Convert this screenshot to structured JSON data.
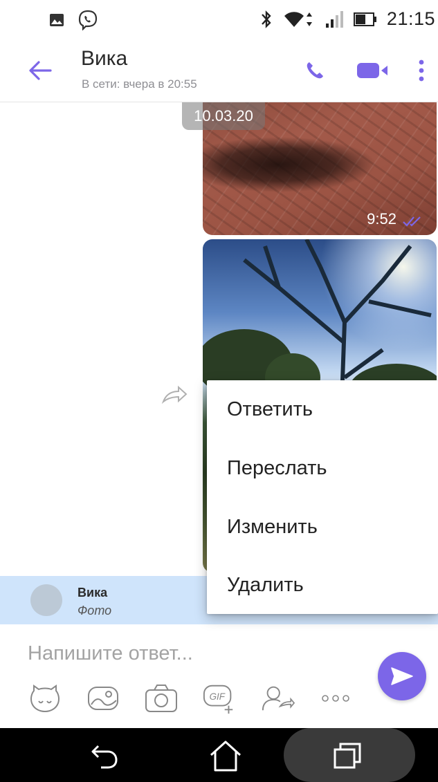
{
  "status_bar": {
    "time": "21:15",
    "icons_left": [
      "image-icon",
      "viber-icon"
    ],
    "icons_right": [
      "bluetooth-icon",
      "wifi-icon",
      "signal-icon",
      "battery-icon"
    ]
  },
  "header": {
    "contact_name": "Вика",
    "contact_status": "В сети: вчера в 20:55",
    "icons": [
      "back-arrow-icon",
      "phone-icon",
      "video-icon",
      "more-vertical-icon"
    ]
  },
  "chat": {
    "date_chip": "10.03.20",
    "messages": [
      {
        "type": "photo",
        "time": "9:52",
        "status": "read"
      },
      {
        "type": "photo"
      }
    ]
  },
  "reply": {
    "name": "Вика",
    "text": "Фото"
  },
  "composer": {
    "placeholder": "Напишите ответ...",
    "tools": [
      "sticker-icon",
      "gallery-icon",
      "camera-icon",
      "gif-icon",
      "share-contact-icon",
      "more-horizontal-icon"
    ]
  },
  "context_menu": {
    "items": [
      {
        "label": "Ответить"
      },
      {
        "label": "Переслать"
      },
      {
        "label": "Изменить"
      },
      {
        "label": "Удалить"
      }
    ]
  },
  "nav_bar": {
    "icons": [
      "back-icon",
      "home-icon",
      "recents-icon"
    ]
  },
  "colors": {
    "accent": "#7c66e8",
    "reply_bg": "#cfe4fb",
    "nav_bg": "#000000"
  }
}
